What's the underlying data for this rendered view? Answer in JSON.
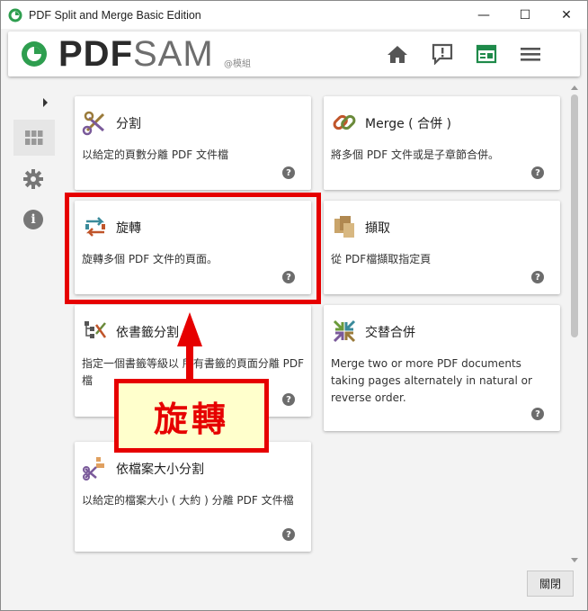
{
  "window": {
    "title": "PDF Split and Merge Basic Edition",
    "controls": {
      "minimize": "—",
      "maximize": "☐",
      "close": "✕"
    }
  },
  "header": {
    "brand_pdf": "PDF",
    "brand_sam": "SAM",
    "brand_sub": "@模組",
    "icons": [
      "home-icon",
      "feedback-icon",
      "news-icon",
      "menu-icon"
    ],
    "accent": "#1e8a4a"
  },
  "sidenav": {
    "icons": [
      "expand-arrow-icon",
      "modules-grid-icon",
      "settings-gear-icon",
      "info-icon"
    ]
  },
  "cards": [
    {
      "title": "分割",
      "desc": "以給定的頁數分離 PDF 文件檔",
      "help": "?"
    },
    {
      "title": "Merge ( 合併 )",
      "desc": "將多個 PDF 文件或是子章節合併。",
      "help": "?"
    },
    {
      "title": "旋轉",
      "desc": "旋轉多個 PDF 文件的頁面。",
      "help": "?"
    },
    {
      "title": "擷取",
      "desc": "從 PDF檔擷取指定頁",
      "help": "?"
    },
    {
      "title": "依書籤分割",
      "desc": "指定一個書籤等級以 所有書籤的頁面分離 PDF 檔",
      "help": "?"
    },
    {
      "title": "交替合併",
      "desc": "Merge two or more PDF documents taking pages alternately in natural or reverse order.",
      "help": "?"
    },
    {
      "title": "依檔案大小分割",
      "desc": "以給定的檔案大小 ( 大約 ) 分離 PDF 文件檔",
      "help": "?"
    }
  ],
  "footer": {
    "close_label": "關閉"
  },
  "annotation": {
    "label": "旋轉",
    "color": "#e60000",
    "fill": "#ffffcc"
  }
}
